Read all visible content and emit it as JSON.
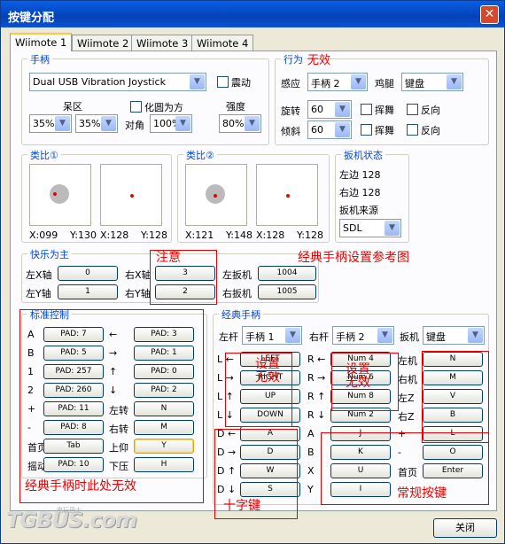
{
  "window": {
    "title": "按键分配",
    "close_glyph": "✕"
  },
  "tabs": [
    "Wiimote 1",
    "Wiimote 2",
    "Wiimote 3",
    "Wiimote 4"
  ],
  "gamepad": {
    "legend": "手柄",
    "device": "Dual USB Vibration Joystick",
    "vibrate": "震动",
    "deadzone_label": "呆区",
    "dz1": "35%",
    "dz2": "35%",
    "circle": "化圆为方",
    "diag_label": "对角",
    "diag": "100%",
    "strength_label": "强度",
    "strength": "80%"
  },
  "behavior": {
    "legend": "行为",
    "note": "无效",
    "sense_label": "感应",
    "sense": "手柄 2",
    "nunchuk_label": "鸡腿",
    "nunchuk": "键盘",
    "rotate_label": "旋转",
    "rotate": "60",
    "tilt_label": "倾斜",
    "tilt": "60",
    "swing": "挥舞",
    "reverse": "反向"
  },
  "analog1": {
    "legend": "类比①",
    "x": "X:099",
    "y": "Y:130",
    "x2": "X:128",
    "y2": "Y:128"
  },
  "analog2": {
    "legend": "类比②",
    "x": "X:121",
    "y": "Y:148",
    "x2": "X:128",
    "y2": "Y:128"
  },
  "trigger": {
    "legend": "扳机状态",
    "left": "左边 128",
    "right": "右边 128",
    "source_label": "扳机来源",
    "source": "SDL"
  },
  "kuaile": {
    "legend": "快乐为主",
    "lx": "左X轴",
    "lx_v": "0",
    "ly": "左Y轴",
    "ly_v": "1",
    "rx": "右X轴",
    "rx_v": "3",
    "ry": "右Y轴",
    "ry_v": "2",
    "lt": "左扳机",
    "lt_v": "1004",
    "rt": "右扳机",
    "rt_v": "1005",
    "note": "注意",
    "note2": "经典手柄设置参考图"
  },
  "standard": {
    "legend": "标准控制",
    "left": [
      [
        "A",
        "PAD: 7"
      ],
      [
        "B",
        "PAD: 5"
      ],
      [
        "1",
        "PAD: 257"
      ],
      [
        "2",
        "PAD: 260"
      ],
      [
        "+",
        "PAD: 11"
      ],
      [
        "-",
        "PAD: 8"
      ],
      [
        "首页",
        "Tab"
      ],
      [
        "摇动",
        "PAD: 10"
      ]
    ],
    "right": [
      [
        "←",
        "PAD: 3"
      ],
      [
        "→",
        "PAD: 1"
      ],
      [
        "↑",
        "PAD: 0"
      ],
      [
        "↓",
        "PAD: 2"
      ],
      [
        "左转",
        "N"
      ],
      [
        "右转",
        "M"
      ],
      [
        "上仰",
        "Y"
      ],
      [
        "下压",
        "H"
      ]
    ],
    "note": "经典手柄时此处无效"
  },
  "classic": {
    "legend": "经典手柄",
    "lstick_label": "左杆",
    "lstick": "手柄 1",
    "rstick_label": "右杆",
    "rstick": "手柄 2",
    "trig_label": "扳机",
    "trig": "键盘",
    "col1": [
      [
        "L ←",
        "LEFT"
      ],
      [
        "L →",
        "RIGHT"
      ],
      [
        "L ↑",
        "UP"
      ],
      [
        "L ↓",
        "DOWN"
      ],
      [
        "D ←",
        "A"
      ],
      [
        "D →",
        "D"
      ],
      [
        "D ↑",
        "W"
      ],
      [
        "D ↓",
        "S"
      ]
    ],
    "col2": [
      [
        "R ←",
        "Num 4"
      ],
      [
        "R →",
        "Num 6"
      ],
      [
        "R ↑",
        "Num 8"
      ],
      [
        "R ↓",
        "Num 2"
      ],
      [
        "A",
        "J"
      ],
      [
        "B",
        "K"
      ],
      [
        "X",
        "U"
      ],
      [
        "Y",
        "I"
      ]
    ],
    "col3": [
      [
        "左机",
        "N"
      ],
      [
        "右机",
        "M"
      ],
      [
        "左Z",
        "V"
      ],
      [
        "右Z",
        "B"
      ],
      [
        "+",
        "L"
      ],
      [
        "-",
        "O"
      ],
      [
        "首页",
        "Enter"
      ]
    ],
    "note_set": "设置\n无效",
    "note_dpad": "十字键",
    "note_keys": "常规按键"
  },
  "footer": {
    "close": "关闭",
    "watermark": "TGBUS.com",
    "watermark2": "电玩巴士"
  }
}
